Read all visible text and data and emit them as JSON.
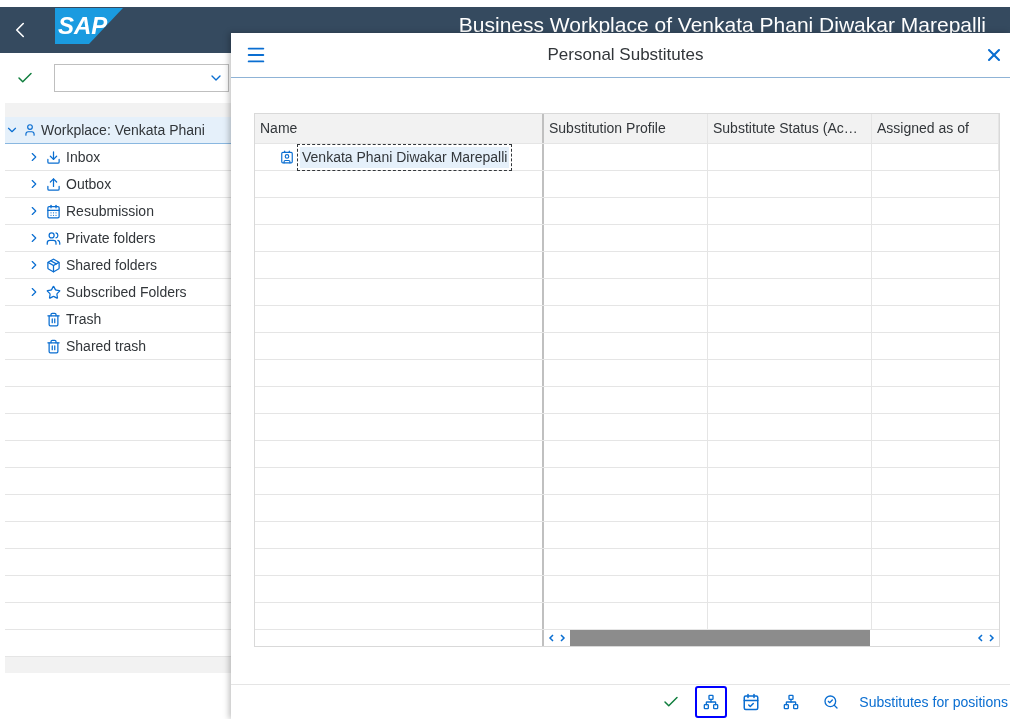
{
  "header": {
    "logo": "SAP",
    "title": "Business Workplace of Venkata Phani Diwakar Marepalli"
  },
  "tree": {
    "label": "Workplace: Venkata Phani",
    "expanded": true,
    "selected": true,
    "children": [
      {
        "label": "Inbox",
        "expandable": true
      },
      {
        "label": "Outbox",
        "expandable": true
      },
      {
        "label": "Resubmission",
        "expandable": true
      },
      {
        "label": "Private folders",
        "expandable": true
      },
      {
        "label": "Shared folders",
        "expandable": true
      },
      {
        "label": "Subscribed Folders",
        "expandable": true
      },
      {
        "label": "Trash",
        "expandable": false
      },
      {
        "label": "Shared trash",
        "expandable": false
      }
    ]
  },
  "dialog": {
    "title": "Personal Substitutes",
    "table": {
      "columns": [
        "Name",
        "Substitution Profile",
        "Substitute Status (Ac…",
        "Assigned as of"
      ],
      "rows": [
        {
          "cells": [
            "Venkata Phani Diwakar Marepalli",
            "",
            "",
            ""
          ],
          "selected": true
        }
      ]
    },
    "footer": {
      "buttons": [
        {
          "kind": "confirm",
          "highlighted": false
        },
        {
          "kind": "assign",
          "highlighted": true
        },
        {
          "kind": "calendar",
          "highlighted": false
        },
        {
          "kind": "remove",
          "highlighted": false
        },
        {
          "kind": "search",
          "highlighted": false
        }
      ],
      "link": "Substitutes for positions"
    }
  }
}
